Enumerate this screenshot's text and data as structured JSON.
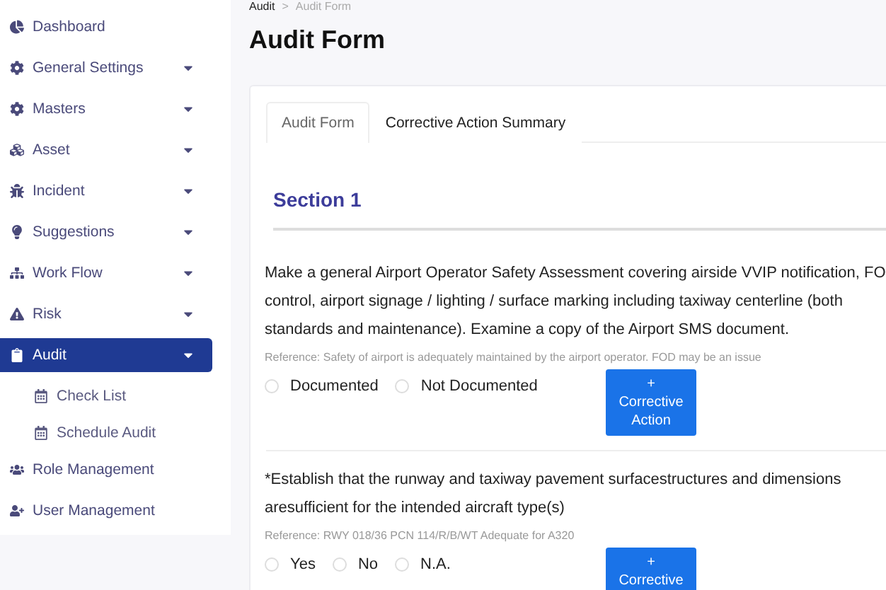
{
  "sidebar": {
    "items": [
      {
        "label": "Dashboard",
        "has_caret": false,
        "selected": false
      },
      {
        "label": "General Settings",
        "has_caret": true,
        "selected": false
      },
      {
        "label": "Masters",
        "has_caret": true,
        "selected": false
      },
      {
        "label": "Asset",
        "has_caret": true,
        "selected": false
      },
      {
        "label": "Incident",
        "has_caret": true,
        "selected": false
      },
      {
        "label": "Suggestions",
        "has_caret": true,
        "selected": false
      },
      {
        "label": "Work Flow",
        "has_caret": true,
        "selected": false
      },
      {
        "label": "Risk",
        "has_caret": true,
        "selected": false
      },
      {
        "label": "Audit",
        "has_caret": true,
        "selected": true,
        "expanded": true,
        "children": [
          {
            "label": "Check List",
            "selected": false
          },
          {
            "label": "Schedule Audit",
            "selected": false
          }
        ]
      },
      {
        "label": "Role Management",
        "has_caret": false,
        "selected": false
      },
      {
        "label": "User Management",
        "has_caret": false,
        "selected": false
      }
    ]
  },
  "breadcrumb": [
    "Audit",
    "Audit Form"
  ],
  "breadcrumb_separator": ">",
  "page_title": "Audit Form",
  "tabs": [
    {
      "label": "Audit Form",
      "selected": true
    },
    {
      "label": "Corrective Action Summary",
      "selected": false
    }
  ],
  "section_title": "Section 1",
  "questions": [
    {
      "lines": [
        "Make a general Airport Operator Safety Assessment covering airside VVIP notification, FO",
        "control, airport signage / lighting / surface marking including taxiway centerline (both",
        "standards and maintenance). Examine a copy of the Airport SMS document."
      ],
      "reference": "Reference: Safety of airport is adequately maintained by the airport operator. FOD may be an issue",
      "options": [
        {
          "label": "Documented",
          "selected": false
        },
        {
          "label": "Not Documented",
          "selected": false
        }
      ],
      "button": [
        "+",
        "Corrective",
        "Action"
      ]
    },
    {
      "lines": [
        "*Establish that the runway and taxiway pavement surfacestructures and dimensions",
        "aresufficient for the intended aircraft type(s)"
      ],
      "reference": "Reference: RWY 018/36 PCN 114/R/B/WT Adequate for A320",
      "options": [
        {
          "label": "Yes",
          "selected": false
        },
        {
          "label": "No",
          "selected": false
        },
        {
          "label": "N.A.",
          "selected": false
        }
      ],
      "button": [
        "+",
        "Corrective"
      ]
    }
  ]
}
